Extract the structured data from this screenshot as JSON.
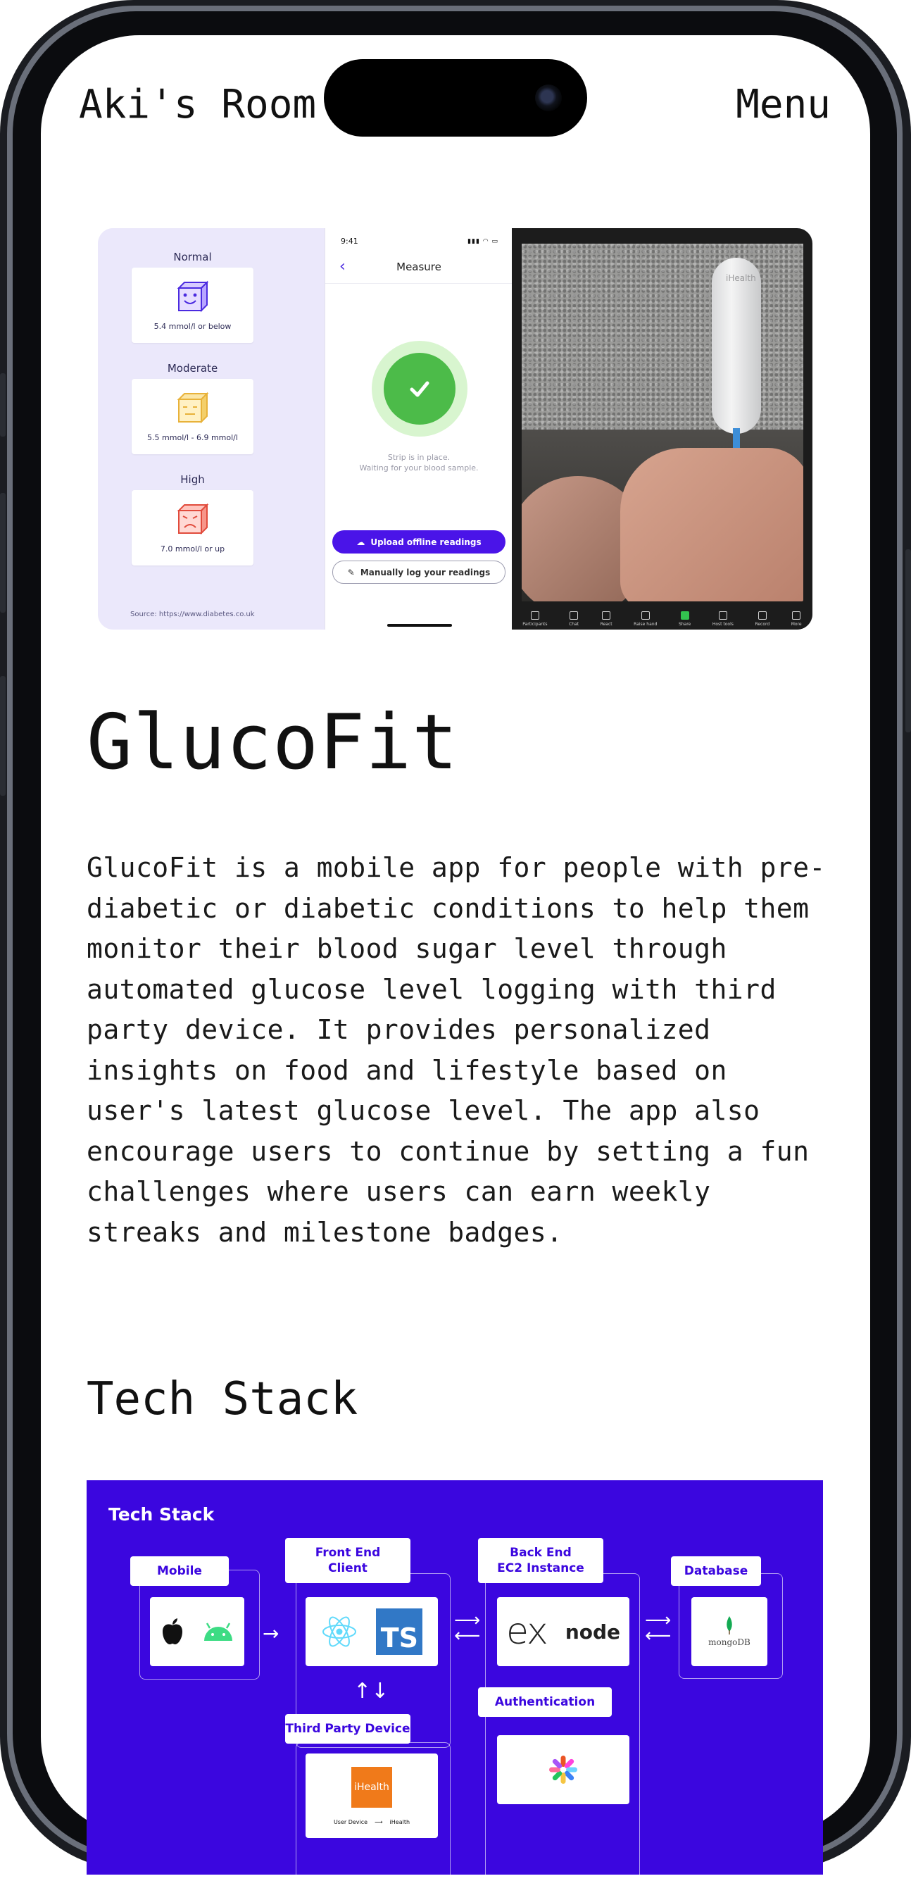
{
  "nav": {
    "title": "Aki's Room",
    "menu": "Menu"
  },
  "hero": {
    "levels": [
      {
        "name": "Normal",
        "range": "5.4 mmol/l or below",
        "color": "#4b2be0"
      },
      {
        "name": "Moderate",
        "range": "5.5 mmol/l - 6.9 mmol/l",
        "color": "#e8b23a"
      },
      {
        "name": "High",
        "range": "7.0 mmol/l or up",
        "color": "#e14b3c"
      }
    ],
    "source": "Source: https://www.diabetes.co.uk",
    "phone": {
      "time": "9:41",
      "title": "Measure",
      "message_line1": "Strip is in place.",
      "message_line2": "Waiting for your blood sample.",
      "btn_upload": "Upload offline readings",
      "btn_manual": "Manually log your readings"
    },
    "video": {
      "device_brand": "iHealth",
      "toolbar": [
        "Participants",
        "Chat",
        "React",
        "Raise hand",
        "Share",
        "Host tools",
        "Record",
        "More"
      ]
    }
  },
  "project": {
    "title": "GlucoFit",
    "description_lines": [
      "GlucoFit is a mobile app for people with pre-",
      "diabetic or diabetic conditions to help them",
      "monitor their blood sugar level through",
      "automated glucose level logging with third",
      "party device. It provides personalized",
      "insights on food and lifestyle based on",
      "user's latest glucose level. The app also",
      "encourage users to continue by setting a fun",
      "challenges where users can earn weekly",
      "streaks and milestone badges."
    ]
  },
  "tech_stack": {
    "heading": "Tech Stack",
    "diagram_title": "Tech Stack",
    "accent": "#3b06df",
    "groups": {
      "mobile": "Mobile",
      "frontend_line1": "Front End",
      "frontend_line2": "Client",
      "backend_line1": "Back End",
      "backend_line2": "EC2 Instance",
      "database": "Database",
      "auth": "Authentication",
      "third_party": "Third Party Device"
    },
    "logos": {
      "ts": "TS",
      "ex": "ex",
      "node": "node",
      "mongo": "mongoDB",
      "ihealth": "iHealth",
      "user_device": "User Device",
      "ihealth_small": "iHealth"
    }
  }
}
